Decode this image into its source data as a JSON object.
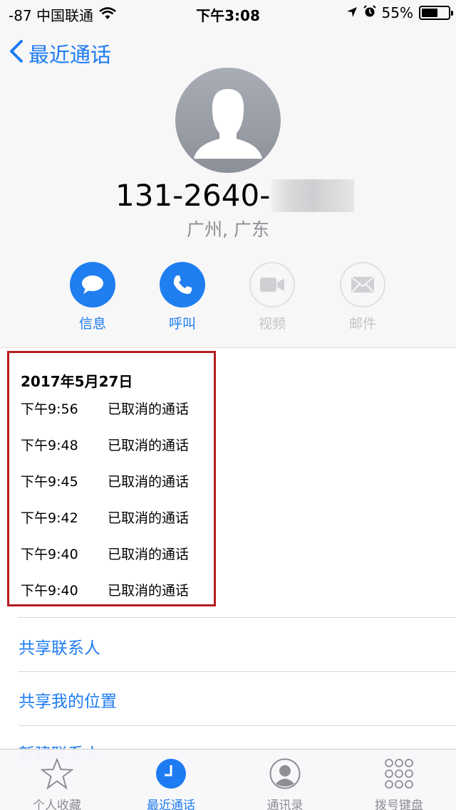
{
  "status_bar": {
    "carrier": "-87 中国联通",
    "time": "下午3:08",
    "battery": "55%",
    "battery_level": 0.55,
    "icons": [
      "wifi-icon",
      "location-arrow-icon",
      "alarm-icon",
      "battery-icon"
    ]
  },
  "nav": {
    "back_label": "最近通话"
  },
  "contact": {
    "number_visible": "131-2640-",
    "location": "广州, 广东"
  },
  "actions": [
    {
      "label": "信息",
      "icon": "message-icon",
      "enabled": true
    },
    {
      "label": "呼叫",
      "icon": "phone-icon",
      "enabled": true
    },
    {
      "label": "视频",
      "icon": "video-icon",
      "enabled": false
    },
    {
      "label": "邮件",
      "icon": "mail-icon",
      "enabled": false
    }
  ],
  "recent_calls": {
    "date": "2017年5月27日",
    "entries": [
      {
        "time": "下午9:56",
        "status": "已取消的通话"
      },
      {
        "time": "下午9:48",
        "status": "已取消的通话"
      },
      {
        "time": "下午9:45",
        "status": "已取消的通话"
      },
      {
        "time": "下午9:42",
        "status": "已取消的通话"
      },
      {
        "time": "下午9:40",
        "status": "已取消的通话"
      },
      {
        "time": "下午9:40",
        "status": "已取消的通话"
      }
    ]
  },
  "options": {
    "share_contact": "共享联系人",
    "share_location": "共享我的位置",
    "new_contact": "新建联系人"
  },
  "tab_bar": {
    "items": [
      {
        "label": "个人收藏",
        "icon": "star-icon",
        "active": false
      },
      {
        "label": "最近通话",
        "icon": "clock-icon",
        "active": true
      },
      {
        "label": "通讯录",
        "icon": "contacts-icon",
        "active": false
      },
      {
        "label": "拨号键盘",
        "icon": "keypad-icon",
        "active": false
      }
    ]
  },
  "colors": {
    "accent": "#1e7cf2",
    "highlight_border": "#b51d1d"
  }
}
